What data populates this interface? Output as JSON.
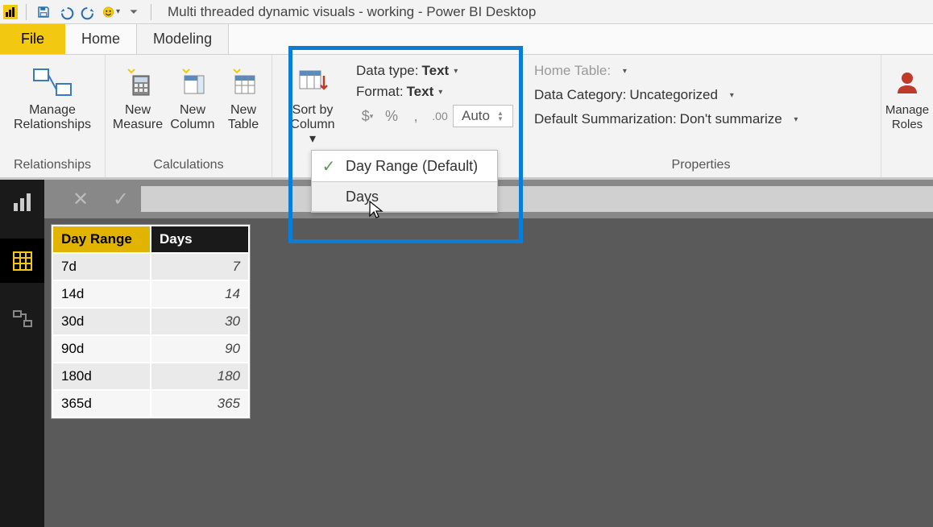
{
  "titlebar": {
    "app_title": "Multi threaded dynamic visuals - working - Power BI Desktop"
  },
  "tabs": {
    "file": "File",
    "home": "Home",
    "modeling": "Modeling"
  },
  "ribbon": {
    "relationships_group": "Relationships",
    "manage_relationships": "Manage Relationships",
    "calculations_group": "Calculations",
    "new_measure": "New Measure",
    "new_column": "New Column",
    "new_table": "New Table",
    "sort_by_column": "Sort by Column",
    "data_type_label": "Data type: ",
    "data_type_value": "Text",
    "format_label": "Format: ",
    "format_value": "Text",
    "auto_label": "Auto",
    "home_table_label": "Home Table:",
    "data_category_label": "Data Category: ",
    "data_category_value": "Uncategorized",
    "default_summarization_label": "Default Summarization: ",
    "default_summarization_value": "Don't summarize",
    "properties_group": "Properties",
    "manage_roles": "Manage Roles"
  },
  "sortby_menu": {
    "item1": "Day Range (Default)",
    "item2": "Days"
  },
  "table": {
    "headers": {
      "c1": "Day Range",
      "c2": "Days"
    },
    "rows": [
      {
        "range": "7d",
        "days": "7"
      },
      {
        "range": "14d",
        "days": "14"
      },
      {
        "range": "30d",
        "days": "30"
      },
      {
        "range": "90d",
        "days": "90"
      },
      {
        "range": "180d",
        "days": "180"
      },
      {
        "range": "365d",
        "days": "365"
      }
    ]
  }
}
